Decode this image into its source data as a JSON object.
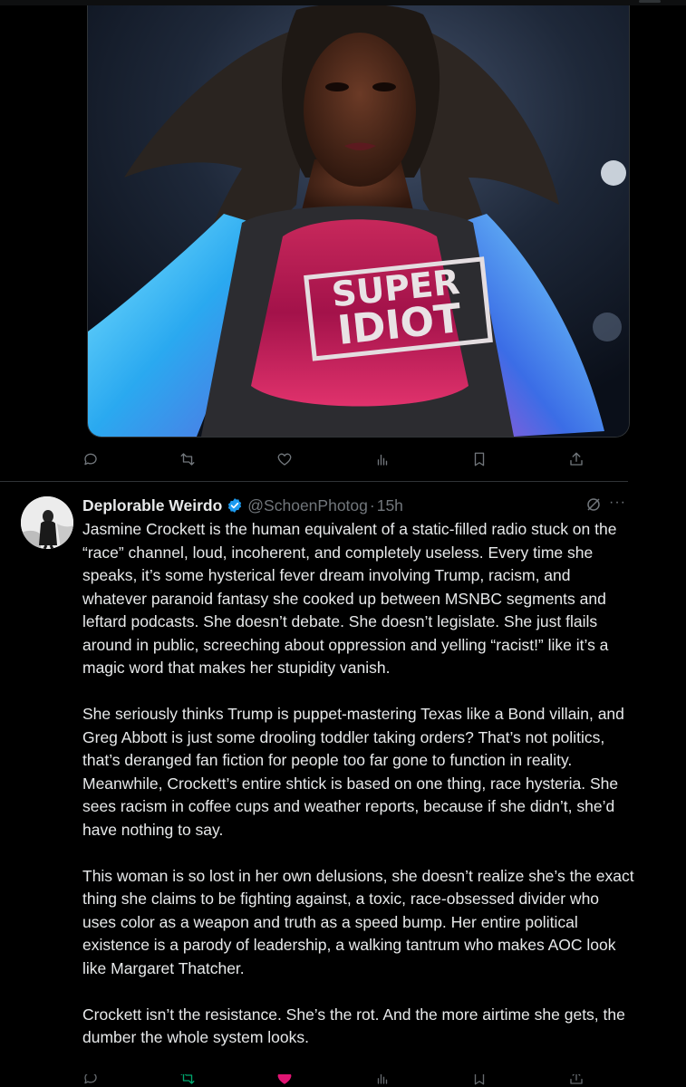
{
  "media": {
    "shirt_text_line1": "SUPER",
    "shirt_text_line2": "IDIOT"
  },
  "actions": [
    {
      "icon": "reply-icon"
    },
    {
      "icon": "retweet-icon"
    },
    {
      "icon": "like-icon"
    },
    {
      "icon": "views-icon"
    },
    {
      "icon": "bookmark-icon"
    },
    {
      "icon": "share-icon"
    }
  ],
  "tweet": {
    "display_name": "Deplorable Weirdo",
    "handle": "@SchoenPhotog",
    "separator": "·",
    "time": "15h",
    "more": "···",
    "paragraphs": [
      "Jasmine Crockett is the human equivalent of a static-filled radio stuck on the “race” channel, loud, incoherent, and completely useless. Every time she speaks, it’s some hysterical fever dream involving Trump, racism, and whatever paranoid fantasy she cooked up between MSNBC segments and leftard podcasts. She doesn’t debate. She doesn’t legislate. She just flails around in public, screeching about oppression and yelling “racist!” like it’s a magic word that makes her stupidity vanish.",
      "She seriously thinks Trump is puppet-mastering Texas like a Bond villain, and Greg Abbott is just some drooling toddler taking orders? That’s not politics, that’s deranged fan fiction for people too far gone to function in reality. Meanwhile, Crockett’s entire shtick is based on one thing, race hysteria. She sees racism in coffee cups and weather reports, because if she didn’t, she’d have nothing to say.",
      "This woman is so lost in her own delusions, she doesn’t realize she’s the exact thing she claims to be fighting against, a toxic, race-obsessed divider who uses color as a weapon and truth as a speed bump. Her entire political existence is a parody of leadership, a walking tantrum who makes AOC look like Margaret Thatcher.",
      "Crockett isn’t the resistance. She’s the rot. And the more airtime she gets, the dumber the whole system looks."
    ]
  },
  "colors": {
    "background": "#000000",
    "text": "#e7e9ea",
    "muted": "#71767b",
    "verified": "#1d9bf0",
    "divider": "#2f3336"
  }
}
